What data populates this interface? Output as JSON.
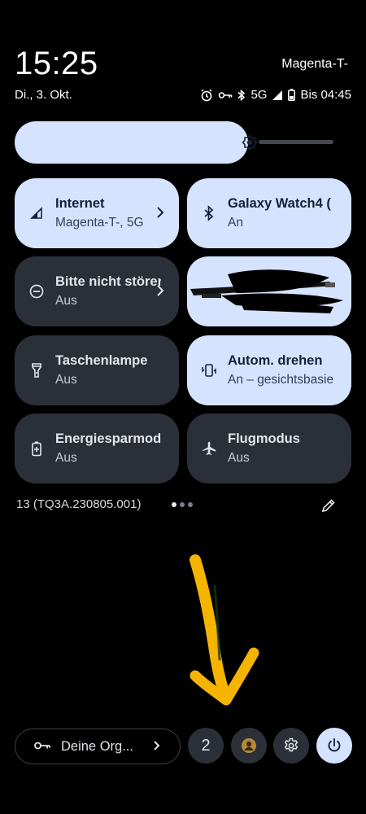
{
  "status_bar": {
    "time": "15:25",
    "carrier": "Magenta-T-",
    "date": "Di., 3. Okt.",
    "network": "5G",
    "battery_text": "Bis 04:45"
  },
  "brightness": {
    "level": 0.72
  },
  "tiles": [
    {
      "title": "Internet",
      "subtitle": "Magenta-T-, 5G",
      "icon": "signal-icon",
      "active": true
    },
    {
      "title": "Galaxy Watch4 (",
      "subtitle": "An",
      "icon": "bluetooth-icon",
      "active": true
    },
    {
      "title": "Bitte nicht stören",
      "subtitle": "Aus",
      "icon": "do-not-disturb-icon",
      "active": false
    },
    {
      "title": "",
      "subtitle": "",
      "icon": "redacted-tile",
      "active": true
    },
    {
      "title": "Taschenlampe",
      "subtitle": "Aus",
      "icon": "flashlight-icon",
      "active": false
    },
    {
      "title": "Autom. drehen",
      "subtitle": "An – gesichtsbasiert",
      "icon": "auto-rotate-icon",
      "active": true
    },
    {
      "title": "Energiesparmodus",
      "subtitle": "Aus",
      "icon": "battery-saver-icon",
      "active": false
    },
    {
      "title": "Flugmodus",
      "subtitle": "Aus",
      "icon": "airplane-icon",
      "active": false
    }
  ],
  "build_number": "13 (TQ3A.230805.001)",
  "pager": {
    "pages": 3,
    "active": 0
  },
  "footer": {
    "org_label": "Deine Org...",
    "user_count": "2"
  },
  "colors": {
    "active_tile": "#d6e3ff",
    "inactive_tile": "#2b3038",
    "annotation": "#f5b400"
  }
}
